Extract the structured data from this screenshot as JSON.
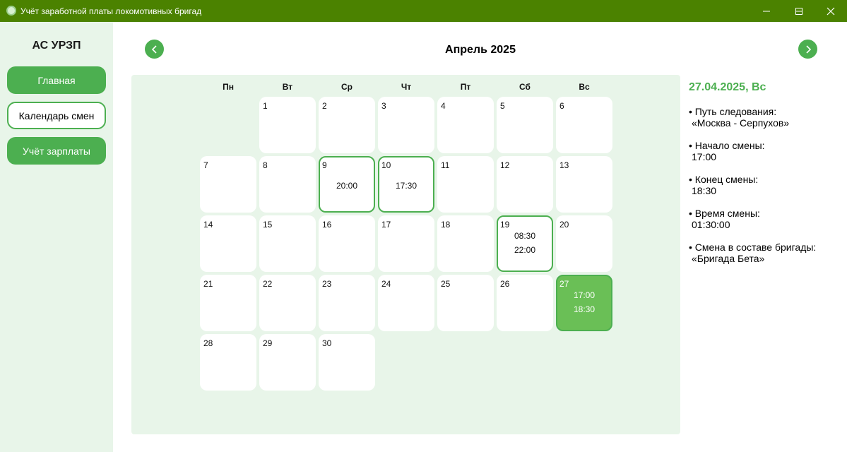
{
  "window": {
    "title": "Учёт заработной платы локомотивных бригад"
  },
  "sidebar": {
    "app_name": "АС УРЗП",
    "items": [
      {
        "label": "Главная"
      },
      {
        "label": "Календарь смен"
      },
      {
        "label": "Учёт зарплаты"
      }
    ]
  },
  "calendar": {
    "month_title": "Апрель 2025",
    "weekdays": [
      "Пн",
      "Вт",
      "Ср",
      "Чт",
      "Пт",
      "Сб",
      "Вс"
    ],
    "days": [
      {
        "n": "1"
      },
      {
        "n": "2"
      },
      {
        "n": "3"
      },
      {
        "n": "4"
      },
      {
        "n": "5"
      },
      {
        "n": "6"
      },
      {
        "n": "7"
      },
      {
        "n": "8"
      },
      {
        "n": "9",
        "times": [
          "20:00"
        ]
      },
      {
        "n": "10",
        "times": [
          "17:30"
        ]
      },
      {
        "n": "11"
      },
      {
        "n": "12"
      },
      {
        "n": "13"
      },
      {
        "n": "14"
      },
      {
        "n": "15"
      },
      {
        "n": "16"
      },
      {
        "n": "17"
      },
      {
        "n": "18"
      },
      {
        "n": "19",
        "times": [
          "08:30",
          "22:00"
        ]
      },
      {
        "n": "20"
      },
      {
        "n": "21"
      },
      {
        "n": "22"
      },
      {
        "n": "23"
      },
      {
        "n": "24"
      },
      {
        "n": "25"
      },
      {
        "n": "26"
      },
      {
        "n": "27",
        "times": [
          "17:00",
          "18:30"
        ],
        "selected": true
      },
      {
        "n": "28"
      },
      {
        "n": "29"
      },
      {
        "n": "30"
      }
    ]
  },
  "details": {
    "date_heading": "27.04.2025, Вс",
    "items": [
      {
        "label": "• Путь следования:",
        "value": "«Москва - Серпухов»"
      },
      {
        "label": "• Начало смены:",
        "value": "17:00"
      },
      {
        "label": "• Конец смены:",
        "value": "18:30"
      },
      {
        "label": "• Время смены:",
        "value": "01:30:00"
      },
      {
        "label": "• Смена в составе бригады:",
        "value": "«Бригада Бета»"
      }
    ]
  },
  "colors": {
    "titlebar": "#4b8200",
    "accent": "#4caf50",
    "panel": "#e8f5e9",
    "selected": "#6abf56"
  }
}
